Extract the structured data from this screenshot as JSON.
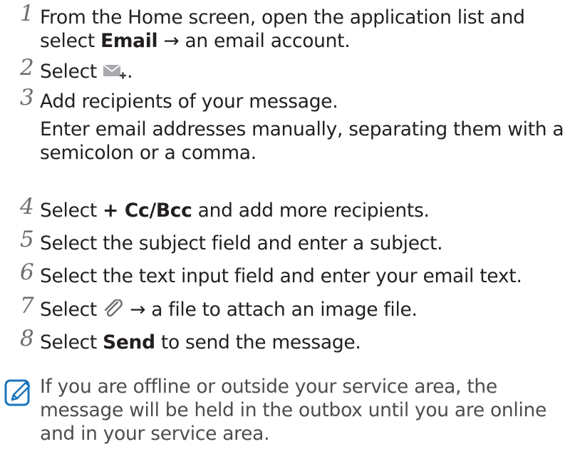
{
  "steps": [
    {
      "num": "1",
      "line1_pre": "From the Home screen, open the application list and",
      "line2_pre": "select ",
      "line2_bold": "Email",
      "line2_post": " → an email account."
    },
    {
      "num": "2",
      "pre": "Select ",
      "post": ".",
      "icon": "new-email-icon"
    },
    {
      "num": "3",
      "para1": "Add recipients of your message.",
      "para2": "Enter email addresses manually, separating them with a semicolon or a comma."
    },
    {
      "num": "4",
      "pre": "Select ",
      "bold": "+ Cc/Bcc",
      "post": " and add more recipients."
    },
    {
      "num": "5",
      "text": "Select the subject field and enter a subject."
    },
    {
      "num": "6",
      "text": "Select the text input field and enter your email text."
    },
    {
      "num": "7",
      "pre": "Select ",
      "post": " → a file to attach an image file.",
      "icon": "paperclip-icon"
    },
    {
      "num": "8",
      "pre": "Select ",
      "bold": "Send",
      "post": " to send the message."
    }
  ],
  "note": {
    "icon": "note-icon",
    "text": "If you are offline or outside your service area, the message will be held in the outbox until you are online and in your service area."
  }
}
